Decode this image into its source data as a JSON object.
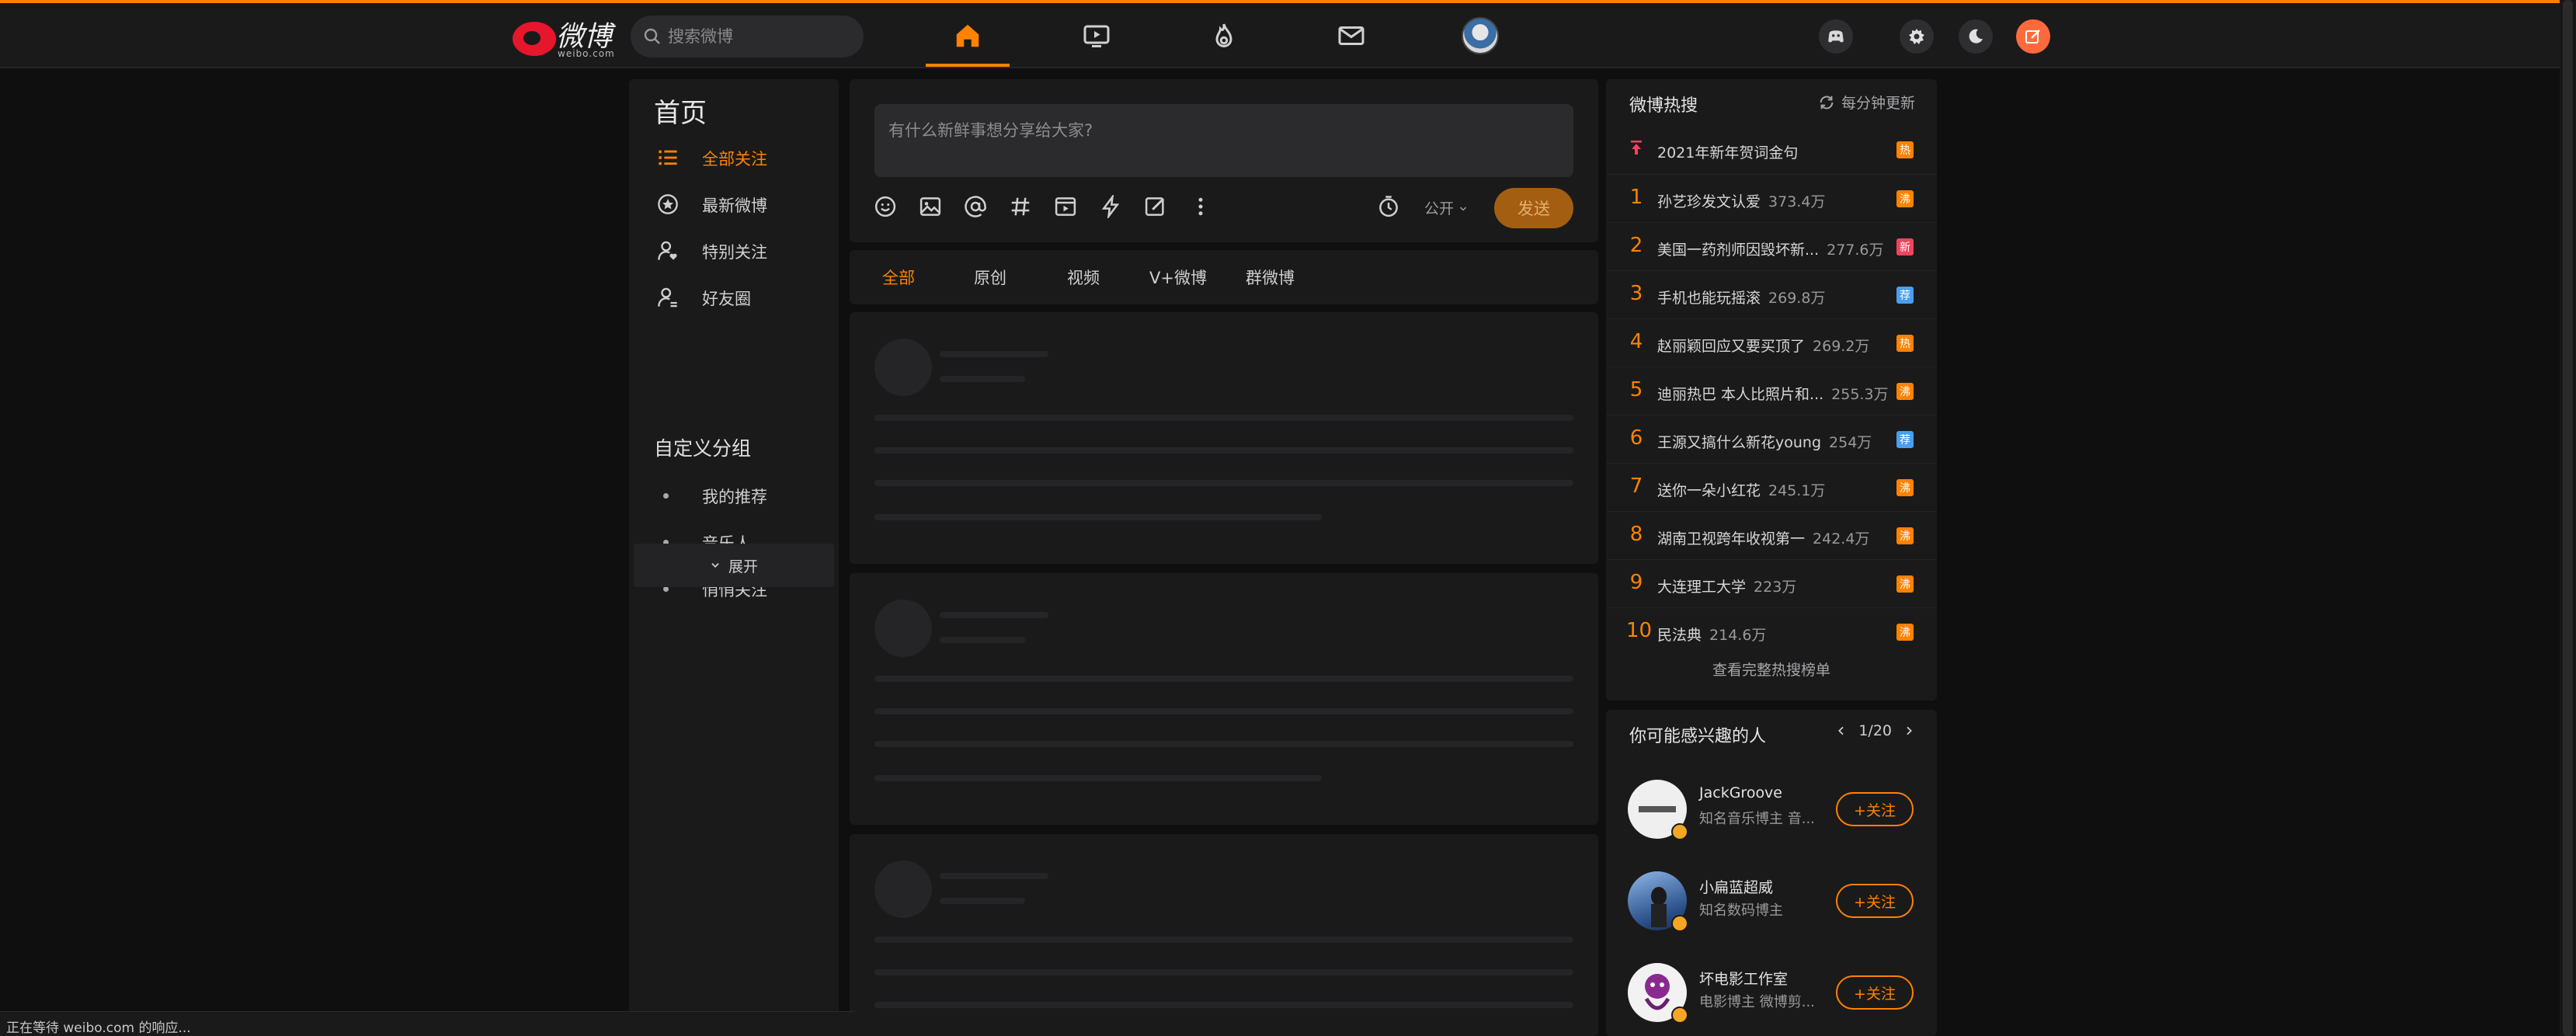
{
  "header": {
    "logo_text": "微博",
    "logo_sub": "weibo.com",
    "search_placeholder": "搜索微博",
    "nav": [
      "home-icon",
      "video-icon",
      "hot-icon",
      "message-icon"
    ]
  },
  "left": {
    "title": "首页",
    "nav": [
      {
        "label": "全部关注",
        "icon": "list-icon",
        "active": true
      },
      {
        "label": "最新微博",
        "icon": "star-icon",
        "active": false
      },
      {
        "label": "特别关注",
        "icon": "user-heart-icon",
        "active": false
      },
      {
        "label": "好友圈",
        "icon": "user-group-icon",
        "active": false
      }
    ],
    "group_title": "自定义分组",
    "groups": [
      "我的推荐",
      "音乐人",
      "悄悄关注"
    ],
    "expand": "展开"
  },
  "composer": {
    "placeholder": "有什么新鲜事想分享给大家?",
    "visibility": "公开",
    "send": "发送",
    "colors": {
      "send_bg": "#a35e11"
    }
  },
  "tabs": [
    "全部",
    "原创",
    "视频",
    "V+微博",
    "群微博"
  ],
  "hot": {
    "title": "微博热搜",
    "refresh": "每分钟更新",
    "pinned": {
      "name": "2021年新年贺词金句",
      "badge": "热"
    },
    "items": [
      {
        "rank": "1",
        "name": "孙艺珍发文认爱",
        "count": "373.4万",
        "badge": "沸"
      },
      {
        "rank": "2",
        "name": "美国一药剂师因毁坏新...",
        "count": "277.6万",
        "badge": "新"
      },
      {
        "rank": "3",
        "name": "手机也能玩摇滚",
        "count": "269.8万",
        "badge": "荐"
      },
      {
        "rank": "4",
        "name": "赵丽颖回应又要买顶了",
        "count": "269.2万",
        "badge": "热"
      },
      {
        "rank": "5",
        "name": "迪丽热巴 本人比照片和...",
        "count": "255.3万",
        "badge": "沸"
      },
      {
        "rank": "6",
        "name": "王源又搞什么新花young",
        "count": "254万",
        "badge": "荐"
      },
      {
        "rank": "7",
        "name": "送你一朵小红花",
        "count": "245.1万",
        "badge": "沸"
      },
      {
        "rank": "8",
        "name": "湖南卫视跨年收视第一",
        "count": "242.4万",
        "badge": "沸"
      },
      {
        "rank": "9",
        "name": "大连理工大学",
        "count": "223万",
        "badge": "沸"
      },
      {
        "rank": "10",
        "name": "民法典",
        "count": "214.6万",
        "badge": "沸"
      }
    ],
    "more": "查看完整热搜榜单",
    "badge_colors": {
      "热": "#ff8200",
      "沸": "#ff8200",
      "新": "#f0445c",
      "荐": "#4a9ef0"
    }
  },
  "recommend": {
    "title": "你可能感兴趣的人",
    "pager": "1/20",
    "people": [
      {
        "name": "JackGroove",
        "desc": "知名音乐博主 音...",
        "follow": "+关注"
      },
      {
        "name": "小扁蓝超威",
        "desc": "知名数码博主",
        "follow": "+关注"
      },
      {
        "name": "坏电影工作室",
        "desc": "电影博主 微博剪...",
        "follow": "+关注"
      }
    ]
  },
  "status": "正在等待 weibo.com 的响应..."
}
